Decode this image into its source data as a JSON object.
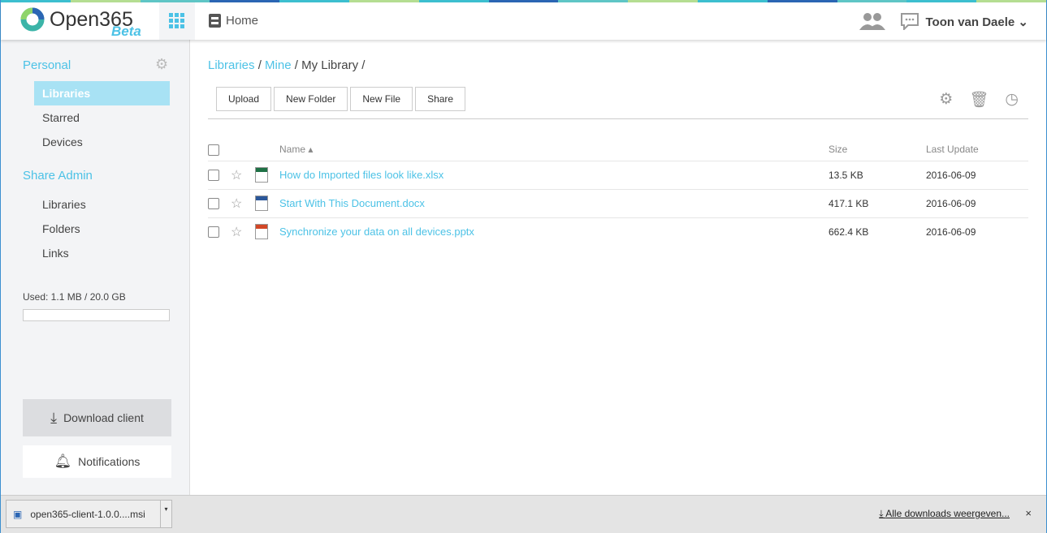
{
  "stripe_colors": [
    "#3cbfd0",
    "#b5de92",
    "#5fc6c6",
    "#2b66b4",
    "#3cbfd0",
    "#b5de92",
    "#3cbfd0",
    "#2b66b4",
    "#5fc6c6",
    "#b5de92",
    "#3cbfd0",
    "#2b66b4",
    "#5fc6c6",
    "#3cbfd0",
    "#b5de92"
  ],
  "header": {
    "logo": "Open365",
    "beta": "Beta",
    "home": "Home",
    "user": "Toon van Daele"
  },
  "sidebar": {
    "personal": "Personal",
    "personal_items": [
      "Libraries",
      "Starred",
      "Devices"
    ],
    "share_admin": "Share Admin",
    "admin_items": [
      "Libraries",
      "Folders",
      "Links"
    ],
    "used": "Used: 1.1 MB / 20.0 GB",
    "usage_fraction": 0.0001,
    "download_client": "Download client",
    "notifications": "Notifications"
  },
  "main": {
    "breadcrumb": [
      "Libraries",
      "Mine",
      "My Library"
    ],
    "toolbar": [
      "Upload",
      "New Folder",
      "New File",
      "Share"
    ],
    "columns": {
      "name": "Name ▴",
      "size": "Size",
      "updated": "Last Update"
    },
    "files": [
      {
        "name": "How do Imported files look like.xlsx",
        "size": "13.5 KB",
        "date": "2016-06-09",
        "color": "#1e7145"
      },
      {
        "name": "Start With This Document.docx",
        "size": "417.1 KB",
        "date": "2016-06-09",
        "color": "#2b579a"
      },
      {
        "name": "Synchronize your data on all devices.pptx",
        "size": "662.4 KB",
        "date": "2016-06-09",
        "color": "#d24726"
      }
    ]
  },
  "downloads": {
    "file": "open365-client-1.0.0....msi",
    "all": "Alle downloads weergeven...",
    "close": "×"
  }
}
